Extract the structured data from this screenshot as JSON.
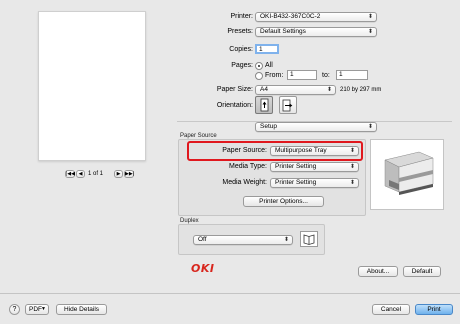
{
  "printer": {
    "label": "Printer:",
    "value": "OKI-B432-367C0C-2"
  },
  "presets": {
    "label": "Presets:",
    "value": "Default Settings"
  },
  "copies": {
    "label": "Copies:",
    "value": "1"
  },
  "pages": {
    "label": "Pages:",
    "all_label": "All",
    "from_label": "From:",
    "from_value": "1",
    "to_label": "to:",
    "to_value": "1"
  },
  "paper_size": {
    "label": "Paper Size:",
    "value": "A4",
    "dims": "210 by 297 mm"
  },
  "orientation": {
    "label": "Orientation:"
  },
  "setup": {
    "value": "Setup"
  },
  "preview": {
    "page_indicator": "1 of 1"
  },
  "paper_source_group": {
    "title": "Paper Source",
    "source_label": "Paper Source:",
    "source_value": "Multipurpose Tray",
    "media_type_label": "Media Type:",
    "media_type_value": "Printer Setting",
    "media_weight_label": "Media Weight:",
    "media_weight_value": "Printer Setting",
    "printer_options_button": "Printer Options..."
  },
  "duplex_group": {
    "title": "Duplex",
    "value": "Off"
  },
  "brand": {
    "logo": "OKI",
    "color": "#d8261d"
  },
  "buttons": {
    "about": "About...",
    "default": "Default",
    "help": "?",
    "pdf": "PDF",
    "hide_details": "Hide Details",
    "cancel": "Cancel",
    "print": "Print"
  },
  "highlight_color": "#e0181e"
}
